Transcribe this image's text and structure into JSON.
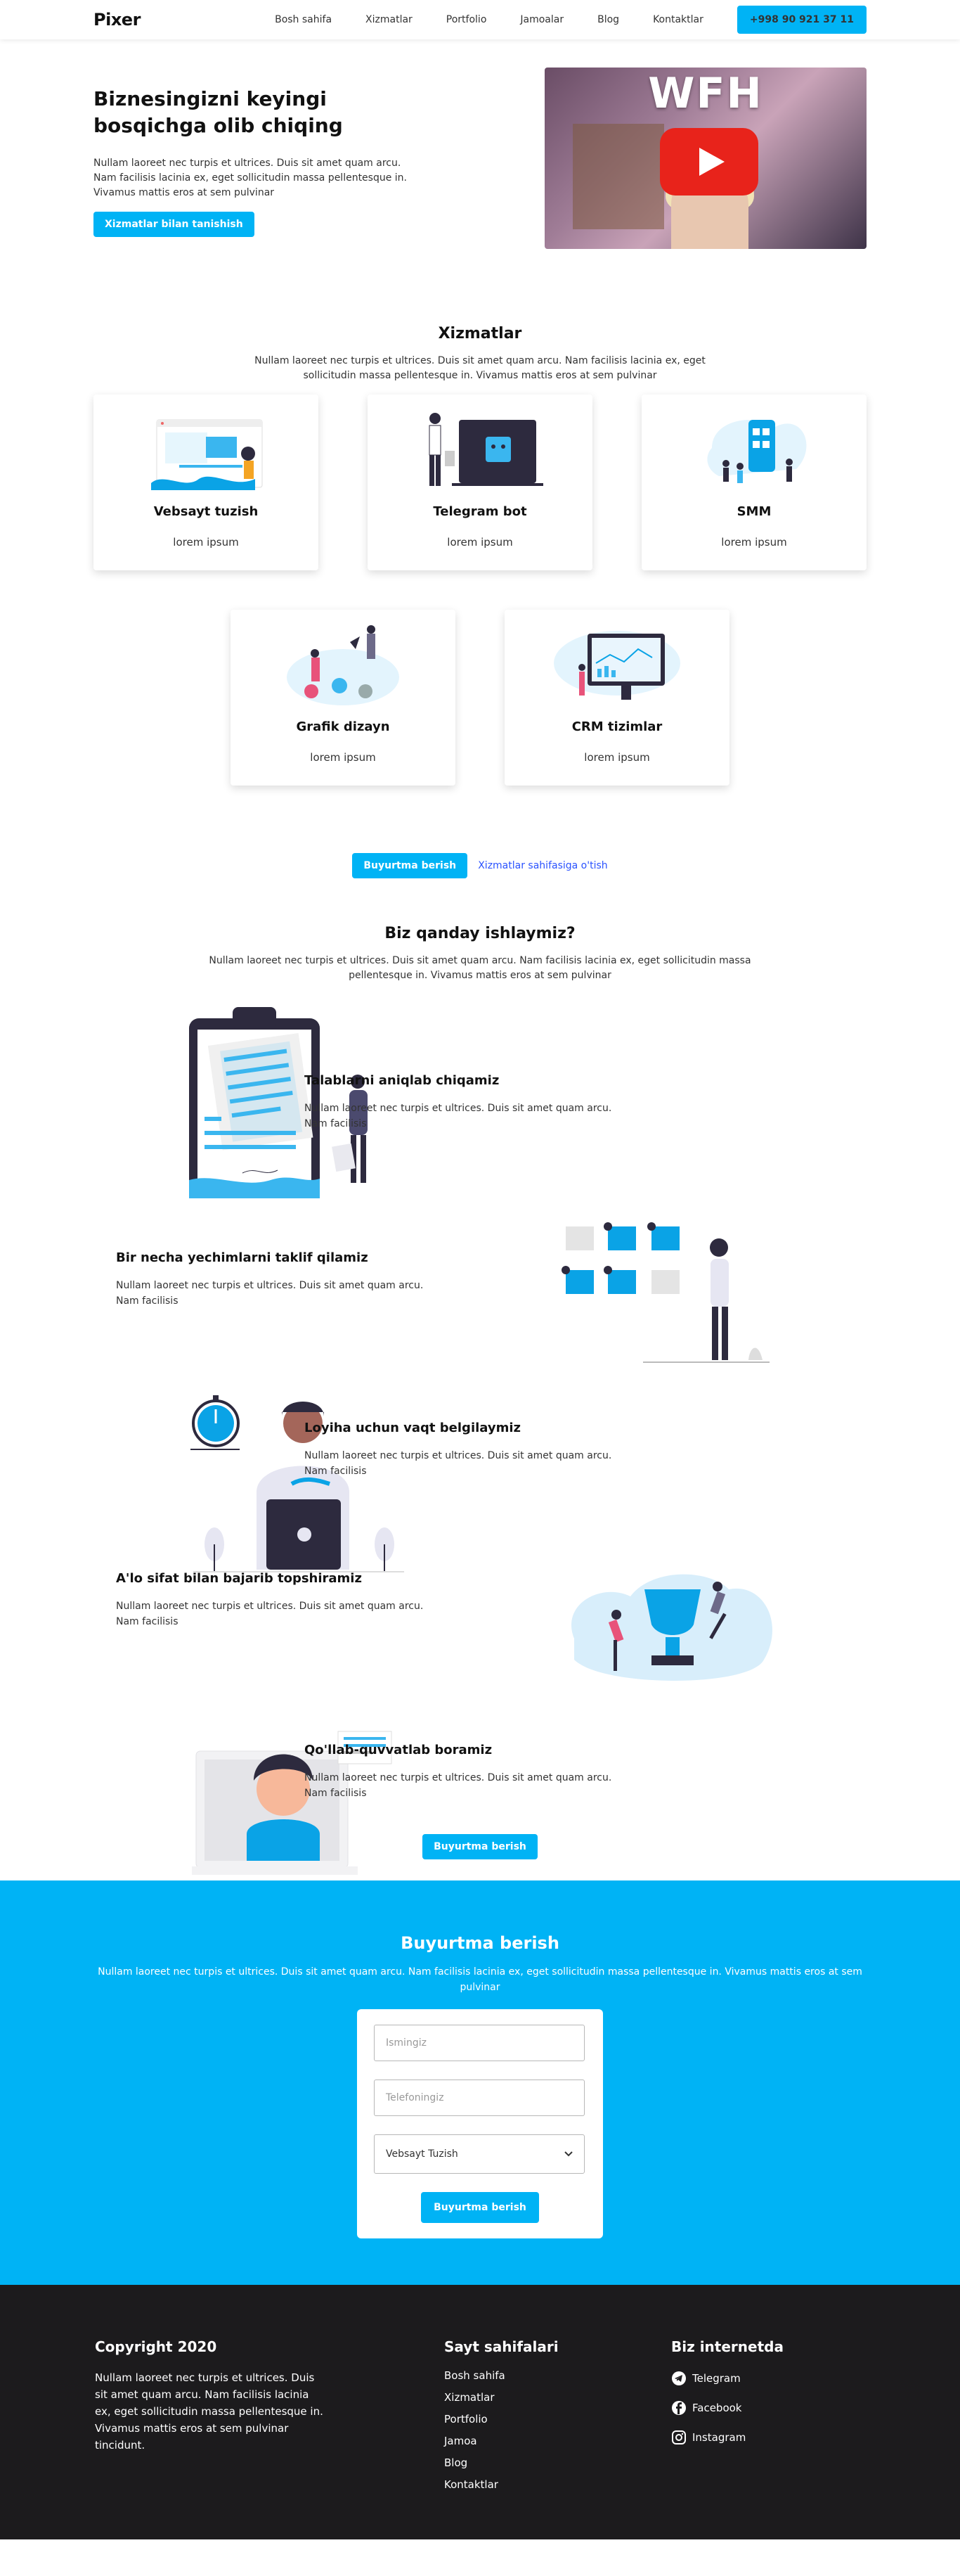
{
  "nav": {
    "logo": "Pixer",
    "items": [
      "Bosh sahifa",
      "Xizmatlar",
      "Portfolio",
      "Jamoalar",
      "Blog",
      "Kontaktlar"
    ],
    "phone": "+998 90 921 37 11"
  },
  "hero": {
    "title": "Biznesingizni keyingi bosqichga olib chiqing",
    "text": "Nullam laoreet nec turpis et ultrices. Duis sit amet quam arcu. Nam facilisis lacinia ex, eget sollicitudin massa pellentesque in. Vivamus mattis eros at sem pulvinar",
    "button": "Xizmatlar bilan tanishish",
    "video_caption": "WFH"
  },
  "services": {
    "title": "Xizmatlar",
    "subtitle": "Nullam laoreet nec turpis et ultrices. Duis sit amet quam arcu. Nam facilisis lacinia ex, eget sollicitudin massa pellentesque in. Vivamus mattis eros at sem pulvinar",
    "cards": [
      {
        "title": "Vebsayt tuzish",
        "text": "lorem ipsum"
      },
      {
        "title": "Telegram bot",
        "text": "lorem ipsum"
      },
      {
        "title": "SMM",
        "text": "lorem ipsum"
      },
      {
        "title": "Grafik dizayn",
        "text": "lorem ipsum"
      },
      {
        "title": "CRM tizimlar",
        "text": "lorem ipsum"
      }
    ],
    "order_button": "Buyurtma berish",
    "more_link": "Xizmatlar sahifasiga o'tish"
  },
  "how": {
    "title": "Biz qanday ishlaymiz?",
    "subtitle": "Nullam laoreet nec turpis et ultrices. Duis sit amet quam arcu. Nam facilisis lacinia ex, eget sollicitudin massa pellentesque in. Vivamus mattis eros at sem pulvinar",
    "steps": [
      {
        "title": "Talablarni aniqlab chiqamiz",
        "text": "Nullam laoreet nec turpis et ultrices. Duis sit amet quam arcu. Nam facilisis"
      },
      {
        "title": "Bir necha yechimlarni taklif qilamiz",
        "text": "Nullam laoreet nec turpis et ultrices. Duis sit amet quam arcu. Nam facilisis"
      },
      {
        "title": "Loyiha uchun vaqt belgilaymiz",
        "text": "Nullam laoreet nec turpis et ultrices. Duis sit amet quam arcu. Nam facilisis"
      },
      {
        "title": "A'lo sifat bilan bajarib topshiramiz",
        "text": "Nullam laoreet nec turpis et ultrices. Duis sit amet quam arcu. Nam facilisis"
      },
      {
        "title": "Qo'llab-quvvatlab boramiz",
        "text": "Nullam laoreet nec turpis et ultrices. Duis sit amet quam arcu. Nam facilisis"
      }
    ],
    "button": "Buyurtma berish"
  },
  "order": {
    "title": "Buyurtma berish",
    "text": "Nullam laoreet nec turpis et ultrices. Duis sit amet quam arcu. Nam facilisis lacinia ex, eget sollicitudin massa pellentesque in. Vivamus mattis eros at sem pulvinar",
    "name_placeholder": "Ismingiz",
    "phone_placeholder": "Telefoningiz",
    "service_selected": "Vebsayt Tuzish",
    "button": "Buyurtma berish"
  },
  "footer": {
    "copyright": "Copyright 2020",
    "text": "Nullam laoreet nec turpis et ultrices. Duis sit amet quam arcu. Nam facilisis lacinia ex, eget sollicitudin massa pellentesque in. Vivamus mattis eros at sem pulvinar tincidunt.",
    "pages_title": "Sayt sahifalari",
    "pages": [
      "Bosh sahifa",
      "Xizmatlar",
      "Portfolio",
      "Jamoa",
      "Blog",
      "Kontaktlar"
    ],
    "social_title": "Biz internetda",
    "social": [
      "Telegram",
      "Facebook",
      "Instagram"
    ]
  },
  "colors": {
    "accent": "#00b3f5",
    "dark": "#1c1b1d",
    "link": "#2a52ff"
  }
}
